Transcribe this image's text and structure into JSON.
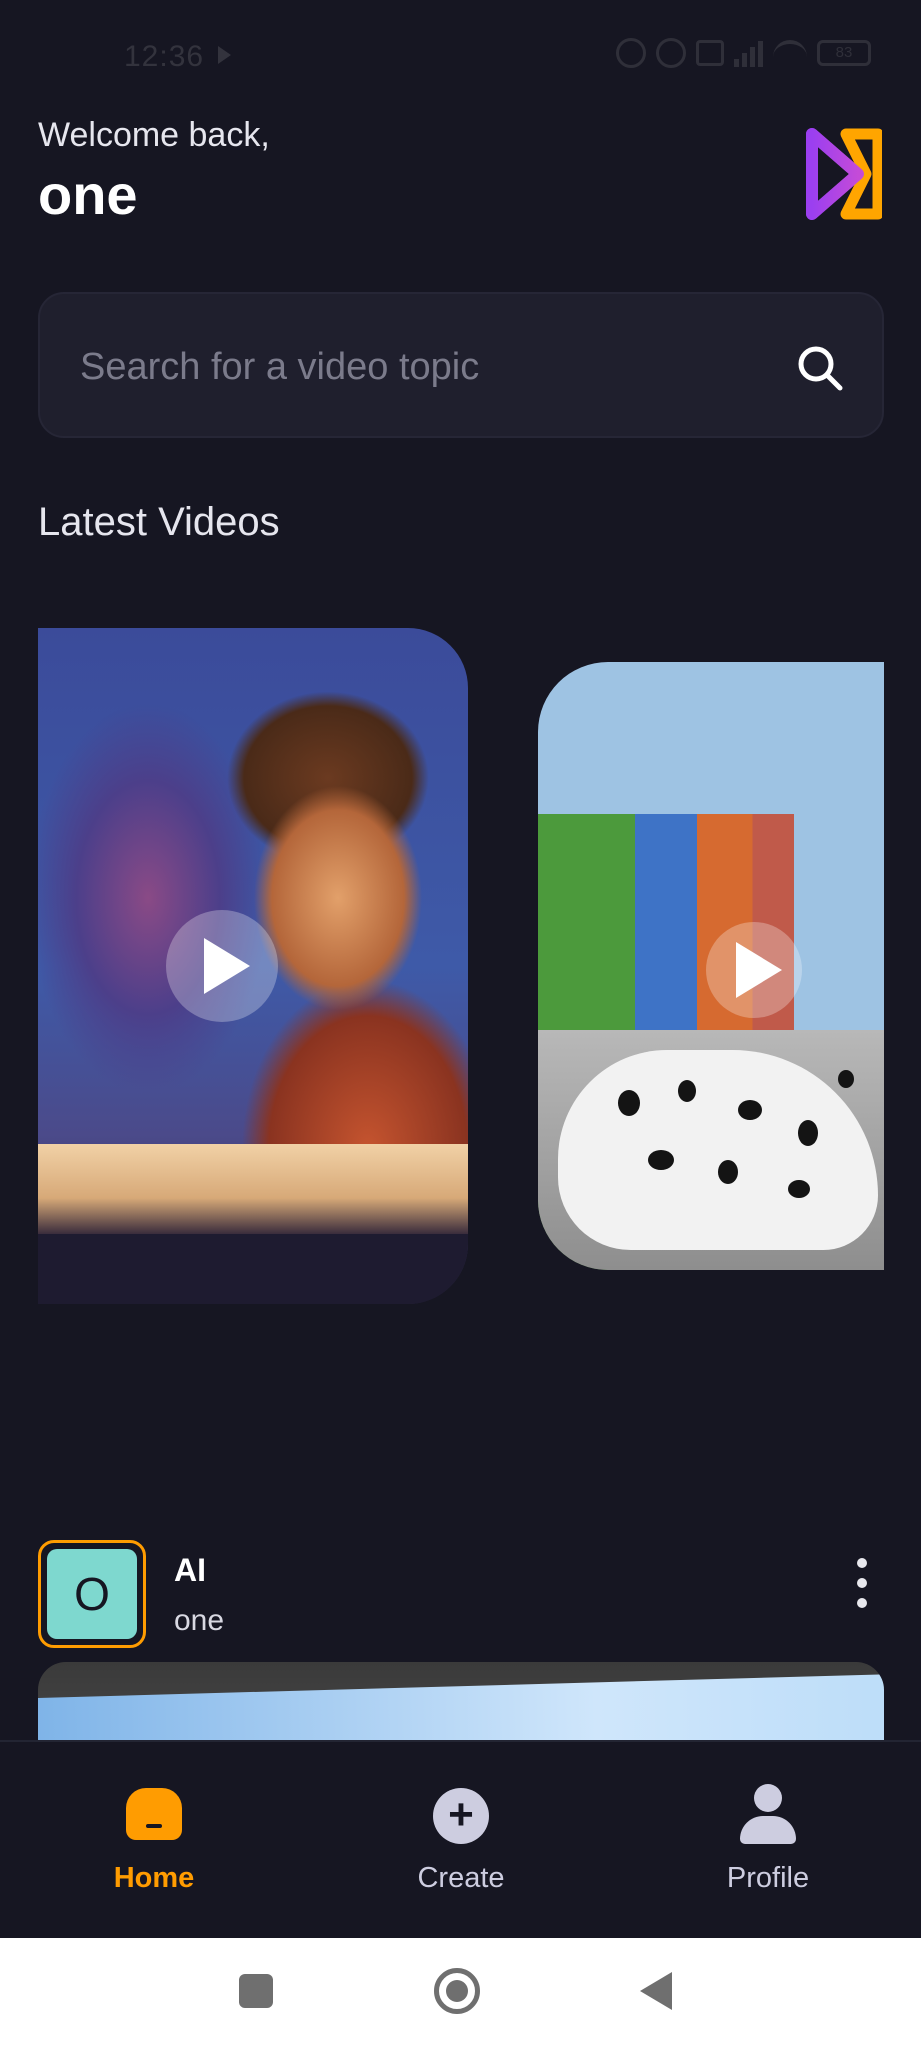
{
  "status_bar": {
    "time": "12:36",
    "battery": "83"
  },
  "header": {
    "welcome": "Welcome back,",
    "username": "one",
    "logo_icon": "play-logo-icon"
  },
  "search": {
    "placeholder": "Search for a video topic",
    "value": "",
    "icon": "search-icon"
  },
  "latest": {
    "title": "Latest Videos"
  },
  "post": {
    "avatar_letter": "O",
    "title": "AI",
    "author": "one"
  },
  "tabs": [
    {
      "label": "Home",
      "icon": "home-icon",
      "active": true
    },
    {
      "label": "Create",
      "icon": "plus-circle-icon",
      "active": false
    },
    {
      "label": "Profile",
      "icon": "user-icon",
      "active": false
    }
  ],
  "colors": {
    "background": "#161622",
    "accent": "#ff9c01",
    "search_bg": "#1f1f2d",
    "avatar_bg": "#7ed8cf"
  }
}
